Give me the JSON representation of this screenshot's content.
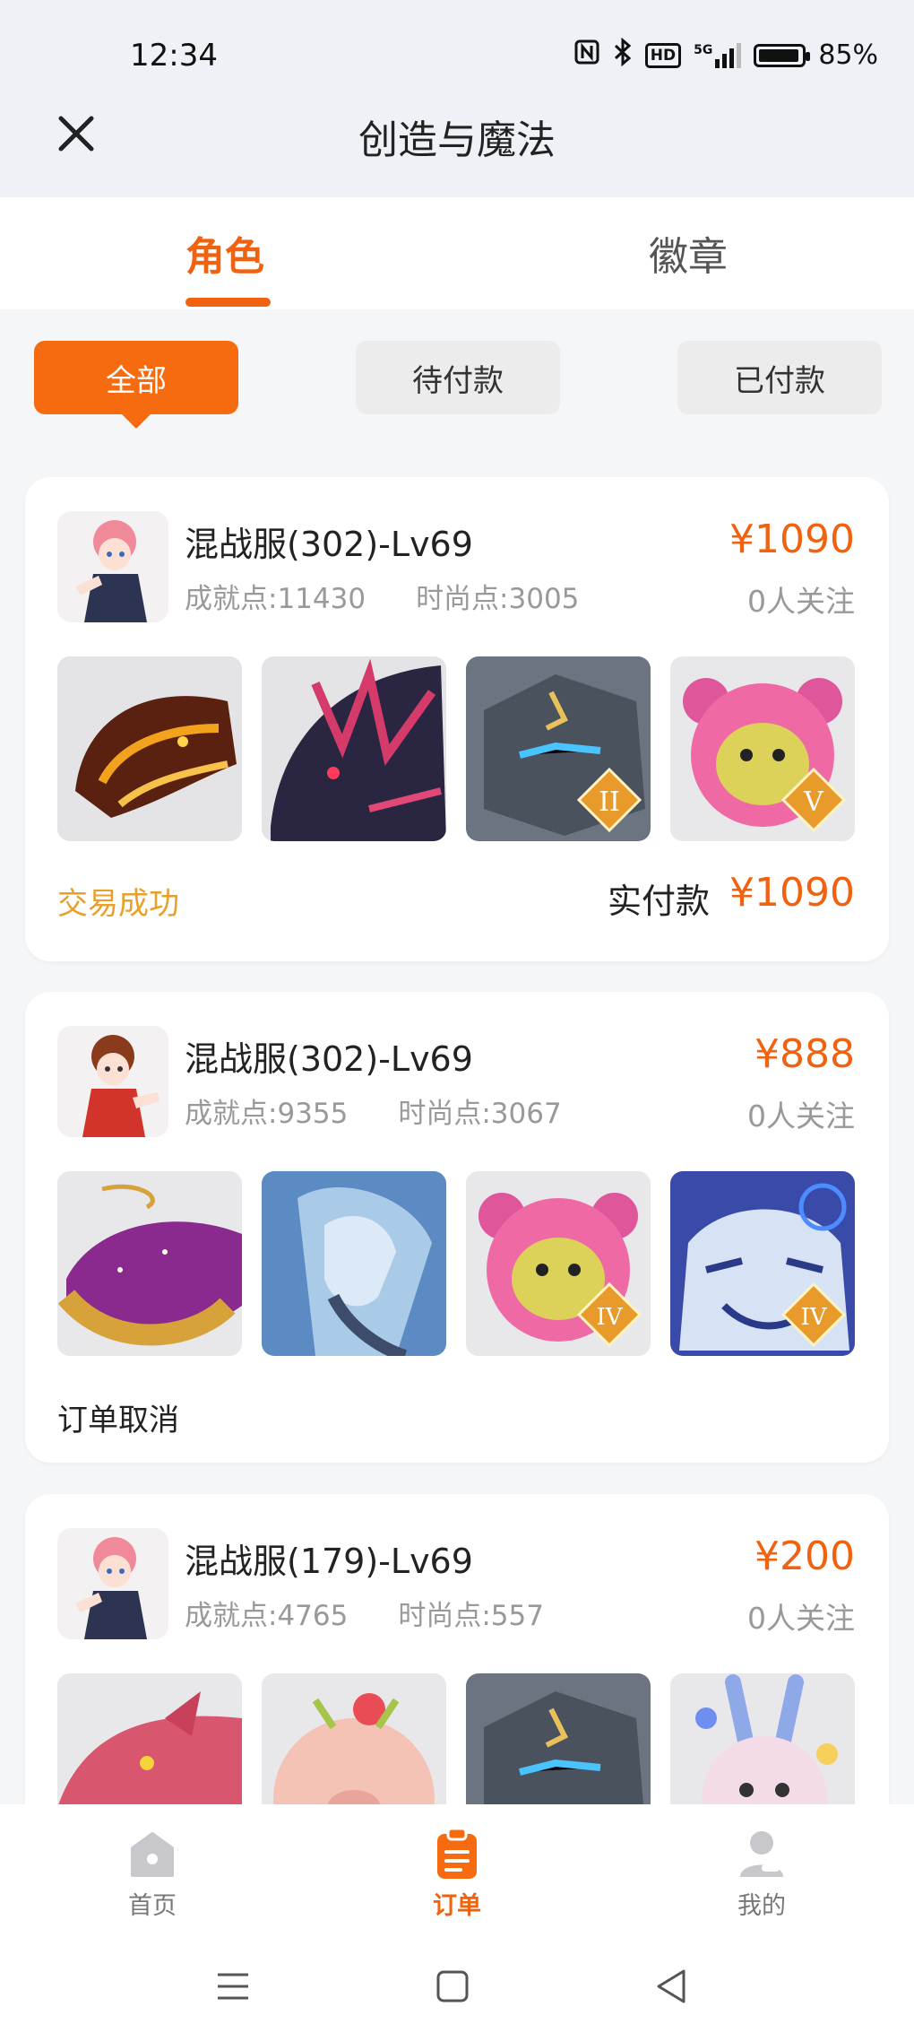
{
  "status_bar": {
    "time": "12:34",
    "icons": [
      "nfc-icon",
      "bluetooth-icon",
      "hd-icon",
      "5g-signal-icon",
      "battery-icon"
    ],
    "hd": "HD",
    "net": "5G",
    "battery_percent": "85%",
    "battery_level": 0.85
  },
  "header": {
    "title": "创造与魔法",
    "close_icon": "close-icon"
  },
  "tabs": [
    {
      "label": "角色",
      "active": true
    },
    {
      "label": "徽章",
      "active": false
    }
  ],
  "filters": [
    {
      "label": "全部",
      "active": true
    },
    {
      "label": "待付款",
      "active": false
    },
    {
      "label": "已付款",
      "active": false
    }
  ],
  "orders": [
    {
      "server": "混战服(302)-Lv69",
      "achievement": "成就点:11430",
      "fashion": "时尚点:3005",
      "price": "¥1090",
      "followers": "0人关注",
      "status": "交易成功",
      "paid_label": "实付款",
      "paid_amount": "¥1090",
      "items": [
        "fire-dragon-mount",
        "dark-dragon-mount",
        "stone-golem-mount",
        "pink-bear-mount"
      ],
      "ranks": [
        "",
        "",
        "II",
        "V"
      ]
    },
    {
      "server": "混战服(302)-Lv69",
      "achievement": "成就点:9355",
      "fashion": "时尚点:3067",
      "price": "¥888",
      "followers": "0人关注",
      "status": "订单取消",
      "items": [
        "golden-whale-mount",
        "ice-phoenix-mount",
        "pink-bear-mount",
        "ice-tiger-mount"
      ],
      "ranks": [
        "",
        "",
        "IV",
        "IV"
      ]
    },
    {
      "server": "混战服(179)-Lv69",
      "achievement": "成就点:4765",
      "fashion": "时尚点:557",
      "price": "¥200",
      "followers": "0人关注",
      "items": [
        "red-dragon-mount",
        "flower-pig-mount",
        "stone-golem-mount",
        "bunny-mount"
      ]
    }
  ],
  "bottom_nav": [
    {
      "label": "首页",
      "icon": "home-icon",
      "active": false
    },
    {
      "label": "订单",
      "icon": "orders-icon",
      "active": true
    },
    {
      "label": "我的",
      "icon": "profile-icon",
      "active": false
    }
  ],
  "colors": {
    "accent": "#f0620f",
    "success": "#e8a02a",
    "muted": "#999999"
  }
}
